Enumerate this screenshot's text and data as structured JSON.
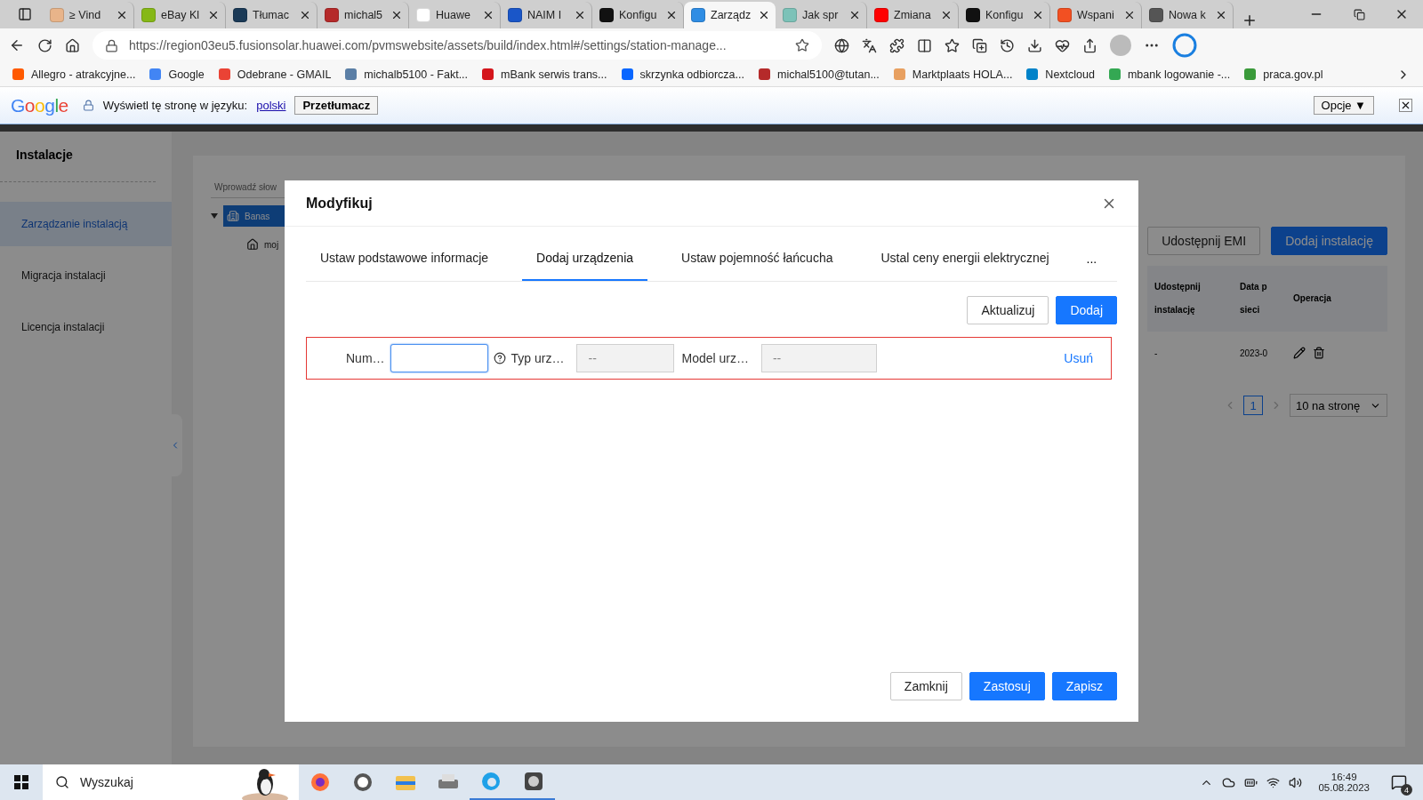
{
  "browser": {
    "tabs": [
      {
        "title": "≥ Vind",
        "selected": false,
        "color": "#e8b48a"
      },
      {
        "title": "eBay Kl",
        "selected": false,
        "color": "#86b817"
      },
      {
        "title": "Tłumac",
        "selected": false,
        "color": "#1b3a57"
      },
      {
        "title": "michal5",
        "selected": false,
        "color": "#b52a2a"
      },
      {
        "title": "Huawe",
        "selected": false,
        "color": "#ffffff"
      },
      {
        "title": "NAIM I",
        "selected": false,
        "color": "#1a56c8"
      },
      {
        "title": "Konfigu",
        "selected": false,
        "color": "#111111"
      },
      {
        "title": "Zarządz",
        "selected": true,
        "color": "#2f8de4"
      },
      {
        "title": "Jak spr",
        "selected": false,
        "color": "#7cc2b8"
      },
      {
        "title": "Zmiana",
        "selected": false,
        "color": "#ff0000"
      },
      {
        "title": "Konfigu",
        "selected": false,
        "color": "#111111"
      },
      {
        "title": "Wspani",
        "selected": false,
        "color": "#f25022"
      },
      {
        "title": "Nowa k",
        "selected": false,
        "color": "#555555"
      }
    ],
    "url": "https://region03eu5.fusionsolar.huawei.com/pvmswebsite/assets/build/index.html#/settings/station-manage...",
    "bookmarks": [
      {
        "label": "Allegro - atrakcyjne...",
        "color": "#ff5a00"
      },
      {
        "label": "Google",
        "color": "#4285f4"
      },
      {
        "label": "Odebrane - GMAIL",
        "color": "#ea4335"
      },
      {
        "label": "michalb5100 - Fakt...",
        "color": "#5b7fa6"
      },
      {
        "label": "mBank serwis trans...",
        "color": "#d4151b"
      },
      {
        "label": "skrzynka odbiorcza...",
        "color": "#0866ff"
      },
      {
        "label": "michal5100@tutan...",
        "color": "#b52a2a"
      },
      {
        "label": "Marktplaats HOLA...",
        "color": "#e8a060"
      },
      {
        "label": "Nextcloud",
        "color": "#0082c9"
      },
      {
        "label": "mbank logowanie -...",
        "color": "#34a853"
      },
      {
        "label": "praca.gov.pl",
        "color": "#3a9a3a"
      }
    ]
  },
  "translate_bar": {
    "logo": "Google",
    "prompt": "Wyświetl tę stronę w języku:",
    "language": "polski",
    "translate_button": "Przetłumacz",
    "options_button": "Opcje ▼"
  },
  "sidebar": {
    "title": "Instalacje",
    "items": [
      {
        "label": "Zarządzanie instalacją",
        "selected": true
      },
      {
        "label": "Migracja instalacji",
        "selected": false
      },
      {
        "label": "Licencja instalacji",
        "selected": false
      }
    ]
  },
  "background": {
    "search_placeholder": "Wprowadź słow",
    "tree": [
      {
        "label": "Banas",
        "selected": true,
        "expanded": true,
        "children": [
          {
            "label": "moj",
            "selected": false
          }
        ]
      }
    ],
    "buttons": [
      {
        "label": "Udostępnij EMI",
        "kind": "default"
      },
      {
        "label": "Dodaj instalację",
        "kind": "primary"
      }
    ],
    "columns": [
      "Udostępnij instalację",
      "Data p sieci",
      "Operacja"
    ],
    "rows": [
      [
        "-",
        "2023-0"
      ]
    ],
    "pagination": {
      "pages": [
        {
          "label": "1",
          "selected": true
        }
      ],
      "page_size": "10 na stronę"
    }
  },
  "modal": {
    "title": "Modyfikuj",
    "tabs": [
      {
        "label": "Ustaw podstawowe informacje",
        "selected": false
      },
      {
        "label": "Dodaj urządzenia",
        "selected": true
      },
      {
        "label": "Ustaw pojemność łańcucha",
        "selected": false
      },
      {
        "label": "Ustal ceny energii elektrycznej",
        "selected": false
      }
    ],
    "more": "...",
    "actions": [
      {
        "label": "Aktualizuj",
        "kind": "default"
      },
      {
        "label": "Dodaj",
        "kind": "primary"
      }
    ],
    "device_rows": [
      {
        "number_label": "Num…",
        "type_label": "Typ urz…",
        "type_value": "--",
        "model_label": "Model urz…",
        "model_value": "--",
        "remove": "Usuń"
      }
    ],
    "footer": [
      {
        "label": "Zamknij",
        "kind": "default"
      },
      {
        "label": "Zastosuj",
        "kind": "primary"
      },
      {
        "label": "Zapisz",
        "kind": "primary"
      }
    ]
  },
  "taskbar": {
    "search_placeholder": "Wyszukaj",
    "time": "16:49",
    "date": "05.08.2023",
    "notifications": "4"
  }
}
